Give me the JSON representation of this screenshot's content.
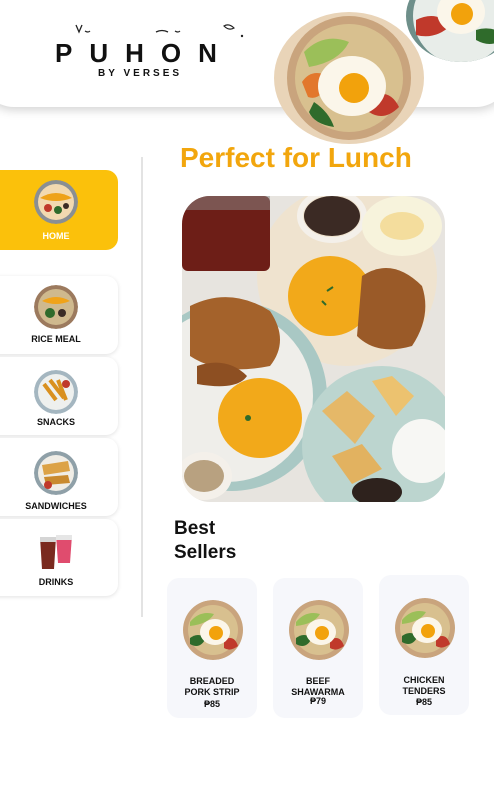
{
  "brand": {
    "name": "PUHON",
    "tagline": "BY VERSES"
  },
  "sidebar": {
    "items": [
      {
        "label": "HOME",
        "active": true,
        "icon": "bowl-icon"
      },
      {
        "label": "RICE MEAL",
        "active": false,
        "icon": "rice-bowl-icon"
      },
      {
        "label": "SNACKS",
        "active": false,
        "icon": "snacks-icon"
      },
      {
        "label": "SANDWICHES",
        "active": false,
        "icon": "sandwich-icon"
      },
      {
        "label": "DRINKS",
        "active": false,
        "icon": "drinks-icon"
      }
    ]
  },
  "main": {
    "title": "Perfect for Lunch",
    "section_title_line1": "Best",
    "section_title_line2": "Sellers",
    "products": [
      {
        "name_line1": "BREADED",
        "name_line2": "PORK STRIP",
        "price": "₱85"
      },
      {
        "name_line1": "BEEF",
        "name_line2": "SHAWARMA",
        "price": "₱79"
      },
      {
        "name_line1": "CHICKEN",
        "name_line2": "TENDERS",
        "price": "₱85"
      }
    ]
  },
  "colors": {
    "accent": "#fbc10b",
    "title": "#f2a60d",
    "card_bg": "#f6f7fb"
  }
}
